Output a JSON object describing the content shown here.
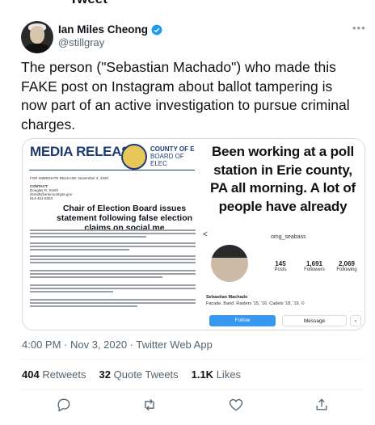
{
  "header": {
    "title": "Tweet"
  },
  "author": {
    "name": "Ian Miles Cheong",
    "handle": "@stillgray"
  },
  "tweet": {
    "text": "The person (\"Sebastian Machado\") who made this FAKE post on Instagram about ballot tampering is now part of an active investigation to pursue criminal charges.",
    "meta": "4:00 PM · Nov 3, 2020 · Twitter Web App"
  },
  "media_release": {
    "title": "MEDIA RELEASE",
    "county_line1": "COUNTY OF E",
    "county_line2": "BOARD OF ELEC",
    "immediate": "FOR IMMEDIATE RELEASE: November 3, 2020",
    "contact": "CONTACT:",
    "contact_name": "Douglas R. Smith",
    "contact_email": "dsmith@eriecountypa.gov",
    "contact_phone": "814-451-6303",
    "headline": "Chair of Election Board issues statement following false election claims on social me"
  },
  "instagram": {
    "caption": "Been working at a poll station in Erie county, PA all morning. A lot of people have already",
    "username": "omg_seabass",
    "posts_count": "145",
    "posts_label": "Posts",
    "followers_count": "1,691",
    "followers_label": "Followers",
    "following_count": "2,069",
    "following_label": "Following",
    "profile_name": "Sebastian Machado",
    "bio": "Facade. Band. Raiders '15, '16. Cadets '18, '19. ©",
    "follow_label": "Follow",
    "message_label": "Message"
  },
  "stats": {
    "retweets_count": "404",
    "retweets_label": "Retweets",
    "quotes_count": "32",
    "quotes_label": "Quote Tweets",
    "likes_count": "1.1K",
    "likes_label": "Likes"
  },
  "colors": {
    "verified": "#1d9bf0",
    "instagram_follow": "#3897f0",
    "release_blue": "#1f3b73"
  },
  "icons": [
    "reply-icon",
    "retweet-icon",
    "like-icon",
    "share-icon",
    "verified-badge-icon",
    "more-icon"
  ]
}
